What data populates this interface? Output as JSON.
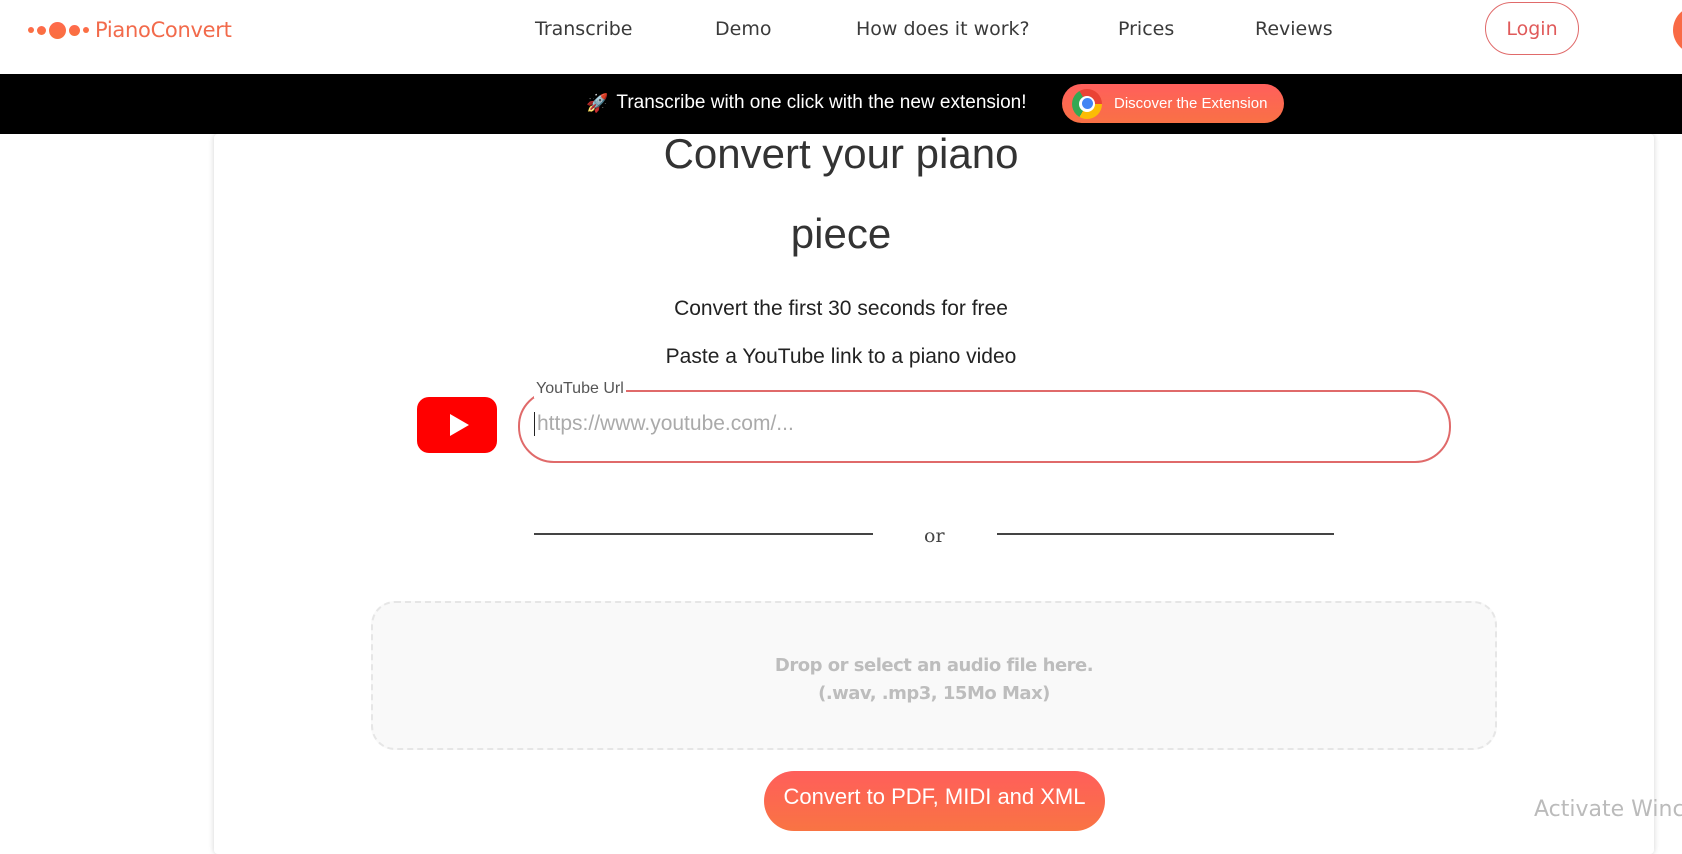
{
  "nav": {
    "brand": "PianoConvert",
    "links": [
      "Transcribe",
      "Demo",
      "How does it work?",
      "Prices",
      "Reviews"
    ],
    "login_label": "Login"
  },
  "promo": {
    "icon": "rocket-icon",
    "text": "Transcribe with one click with the new extension!",
    "button_icon": "chrome-icon",
    "button_label": "Discover the Extension"
  },
  "main": {
    "title_line1": "Convert your piano",
    "title_line2": "piece",
    "subtitle": "Convert the first 30 seconds for free",
    "instruction": "Paste a YouTube link to a piano video",
    "url_field": {
      "label": "YouTube Url",
      "value": "",
      "placeholder": "https://www.youtube.com/..."
    },
    "divider_text": "or",
    "dropzone": {
      "line1": "Drop or select an audio file here.",
      "line2": "(.wav, .mp3, 15Mo Max)"
    },
    "convert_label": "Convert to PDF, MIDI and XML"
  },
  "colors": {
    "brand": "#f26a4b",
    "accent_red": "#e06a6a",
    "youtube_red": "#ff0000"
  },
  "overlay": {
    "watermark": "Activate Winc"
  }
}
